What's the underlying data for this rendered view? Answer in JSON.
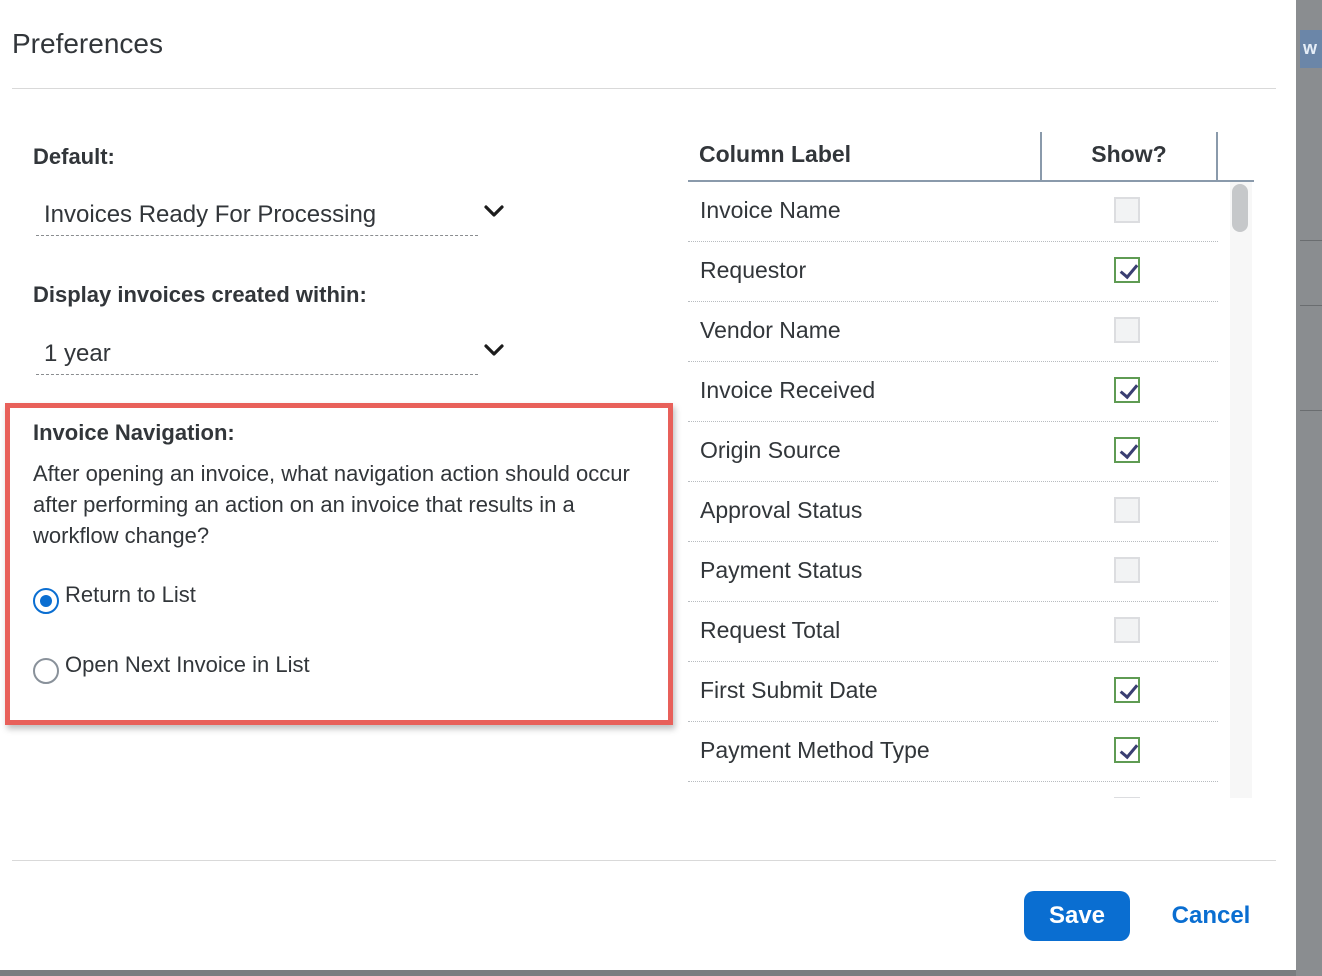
{
  "dialog": {
    "title": "Preferences"
  },
  "default_field": {
    "label": "Default:",
    "value": "Invoices Ready For Processing"
  },
  "display_field": {
    "label": "Display invoices created within:",
    "value": "1 year"
  },
  "invoice_navigation": {
    "title": "Invoice Navigation:",
    "description": "After opening an invoice, what navigation action should occur after performing an action on an invoice that results in a workflow change?",
    "options": [
      {
        "label": "Return to List",
        "selected": true
      },
      {
        "label": "Open Next Invoice in List",
        "selected": false
      }
    ]
  },
  "columns_table": {
    "header_label": "Column Label",
    "header_show": "Show?",
    "rows": [
      {
        "label": "Invoice Name",
        "show": false
      },
      {
        "label": "Requestor",
        "show": true
      },
      {
        "label": "Vendor Name",
        "show": false
      },
      {
        "label": "Invoice Received",
        "show": true
      },
      {
        "label": "Origin Source",
        "show": true
      },
      {
        "label": "Approval Status",
        "show": false
      },
      {
        "label": "Payment Status",
        "show": false
      },
      {
        "label": "Request Total",
        "show": false
      },
      {
        "label": "First Submit Date",
        "show": true
      },
      {
        "label": "Payment Method Type",
        "show": true
      }
    ]
  },
  "footer": {
    "save_label": "Save",
    "cancel_label": "Cancel"
  },
  "background": {
    "partial_text": "w"
  },
  "colors": {
    "accent": "#0a6ed1",
    "highlight_border": "#e8605a",
    "checkbox_border_on": "#5f9b53"
  }
}
